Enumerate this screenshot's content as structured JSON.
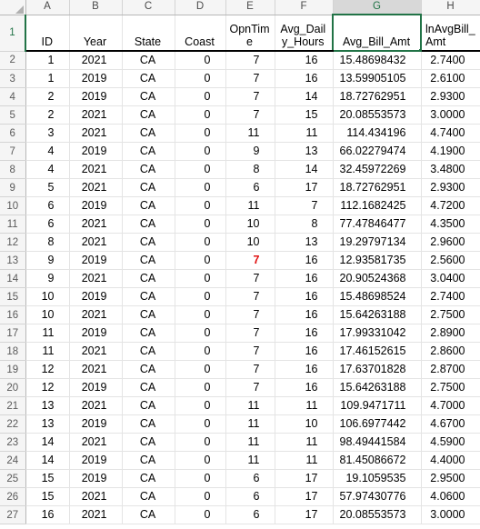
{
  "app": {
    "name": "spreadsheet",
    "active_cell": "G1",
    "selected_column": "G",
    "accent_color": "#217346",
    "alert_color": "#e01010"
  },
  "columns": {
    "letters": [
      "A",
      "B",
      "C",
      "D",
      "E",
      "F",
      "G",
      "H"
    ]
  },
  "headers": {
    "A": "ID",
    "B": "Year",
    "C": "State",
    "D": "Coast",
    "E": "OpnTime",
    "F": "Avg_Daily_Hours",
    "G": "Avg_Bill_Amt",
    "H": "lnAvgBill_Amt"
  },
  "row_numbers": [
    1,
    2,
    3,
    4,
    5,
    6,
    7,
    8,
    9,
    10,
    11,
    12,
    13,
    14,
    15,
    16,
    17,
    18,
    19,
    20,
    21,
    22,
    23,
    24,
    25,
    26,
    27
  ],
  "rows": [
    {
      "row": 2,
      "ID": "1",
      "Year": "2021",
      "State": "CA",
      "Coast": "0",
      "OpnTime": "7",
      "Avg_Daily_Hours": "16",
      "Avg_Bill_Amt": "15.48698432",
      "lnAvgBill_Amt": "2.7400",
      "opntime_red": false
    },
    {
      "row": 3,
      "ID": "1",
      "Year": "2019",
      "State": "CA",
      "Coast": "0",
      "OpnTime": "7",
      "Avg_Daily_Hours": "16",
      "Avg_Bill_Amt": "13.59905105",
      "lnAvgBill_Amt": "2.6100",
      "opntime_red": false
    },
    {
      "row": 4,
      "ID": "2",
      "Year": "2019",
      "State": "CA",
      "Coast": "0",
      "OpnTime": "7",
      "Avg_Daily_Hours": "14",
      "Avg_Bill_Amt": "18.72762951",
      "lnAvgBill_Amt": "2.9300",
      "opntime_red": false
    },
    {
      "row": 5,
      "ID": "2",
      "Year": "2021",
      "State": "CA",
      "Coast": "0",
      "OpnTime": "7",
      "Avg_Daily_Hours": "15",
      "Avg_Bill_Amt": "20.08553573",
      "lnAvgBill_Amt": "3.0000",
      "opntime_red": false
    },
    {
      "row": 6,
      "ID": "3",
      "Year": "2021",
      "State": "CA",
      "Coast": "0",
      "OpnTime": "11",
      "Avg_Daily_Hours": "11",
      "Avg_Bill_Amt": "114.434196",
      "lnAvgBill_Amt": "4.7400",
      "opntime_red": false
    },
    {
      "row": 7,
      "ID": "4",
      "Year": "2019",
      "State": "CA",
      "Coast": "0",
      "OpnTime": "9",
      "Avg_Daily_Hours": "13",
      "Avg_Bill_Amt": "66.02279474",
      "lnAvgBill_Amt": "4.1900",
      "opntime_red": false
    },
    {
      "row": 8,
      "ID": "4",
      "Year": "2021",
      "State": "CA",
      "Coast": "0",
      "OpnTime": "8",
      "Avg_Daily_Hours": "14",
      "Avg_Bill_Amt": "32.45972269",
      "lnAvgBill_Amt": "3.4800",
      "opntime_red": false
    },
    {
      "row": 9,
      "ID": "5",
      "Year": "2021",
      "State": "CA",
      "Coast": "0",
      "OpnTime": "6",
      "Avg_Daily_Hours": "17",
      "Avg_Bill_Amt": "18.72762951",
      "lnAvgBill_Amt": "2.9300",
      "opntime_red": false
    },
    {
      "row": 10,
      "ID": "6",
      "Year": "2019",
      "State": "CA",
      "Coast": "0",
      "OpnTime": "11",
      "Avg_Daily_Hours": "7",
      "Avg_Bill_Amt": "112.1682425",
      "lnAvgBill_Amt": "4.7200",
      "opntime_red": false
    },
    {
      "row": 11,
      "ID": "6",
      "Year": "2021",
      "State": "CA",
      "Coast": "0",
      "OpnTime": "10",
      "Avg_Daily_Hours": "8",
      "Avg_Bill_Amt": "77.47846477",
      "lnAvgBill_Amt": "4.3500",
      "opntime_red": false
    },
    {
      "row": 12,
      "ID": "8",
      "Year": "2021",
      "State": "CA",
      "Coast": "0",
      "OpnTime": "10",
      "Avg_Daily_Hours": "13",
      "Avg_Bill_Amt": "19.29797134",
      "lnAvgBill_Amt": "2.9600",
      "opntime_red": false
    },
    {
      "row": 13,
      "ID": "9",
      "Year": "2019",
      "State": "CA",
      "Coast": "0",
      "OpnTime": "7",
      "Avg_Daily_Hours": "16",
      "Avg_Bill_Amt": "12.93581735",
      "lnAvgBill_Amt": "2.5600",
      "opntime_red": true
    },
    {
      "row": 14,
      "ID": "9",
      "Year": "2021",
      "State": "CA",
      "Coast": "0",
      "OpnTime": "7",
      "Avg_Daily_Hours": "16",
      "Avg_Bill_Amt": "20.90524368",
      "lnAvgBill_Amt": "3.0400",
      "opntime_red": false
    },
    {
      "row": 15,
      "ID": "10",
      "Year": "2019",
      "State": "CA",
      "Coast": "0",
      "OpnTime": "7",
      "Avg_Daily_Hours": "16",
      "Avg_Bill_Amt": "15.48698524",
      "lnAvgBill_Amt": "2.7400",
      "opntime_red": false
    },
    {
      "row": 16,
      "ID": "10",
      "Year": "2021",
      "State": "CA",
      "Coast": "0",
      "OpnTime": "7",
      "Avg_Daily_Hours": "16",
      "Avg_Bill_Amt": "15.64263188",
      "lnAvgBill_Amt": "2.7500",
      "opntime_red": false
    },
    {
      "row": 17,
      "ID": "11",
      "Year": "2019",
      "State": "CA",
      "Coast": "0",
      "OpnTime": "7",
      "Avg_Daily_Hours": "16",
      "Avg_Bill_Amt": "17.99331042",
      "lnAvgBill_Amt": "2.8900",
      "opntime_red": false
    },
    {
      "row": 18,
      "ID": "11",
      "Year": "2021",
      "State": "CA",
      "Coast": "0",
      "OpnTime": "7",
      "Avg_Daily_Hours": "16",
      "Avg_Bill_Amt": "17.46152615",
      "lnAvgBill_Amt": "2.8600",
      "opntime_red": false
    },
    {
      "row": 19,
      "ID": "12",
      "Year": "2021",
      "State": "CA",
      "Coast": "0",
      "OpnTime": "7",
      "Avg_Daily_Hours": "16",
      "Avg_Bill_Amt": "17.63701828",
      "lnAvgBill_Amt": "2.8700",
      "opntime_red": false
    },
    {
      "row": 20,
      "ID": "12",
      "Year": "2019",
      "State": "CA",
      "Coast": "0",
      "OpnTime": "7",
      "Avg_Daily_Hours": "16",
      "Avg_Bill_Amt": "15.64263188",
      "lnAvgBill_Amt": "2.7500",
      "opntime_red": false
    },
    {
      "row": 21,
      "ID": "13",
      "Year": "2021",
      "State": "CA",
      "Coast": "0",
      "OpnTime": "11",
      "Avg_Daily_Hours": "11",
      "Avg_Bill_Amt": "109.9471711",
      "lnAvgBill_Amt": "4.7000",
      "opntime_red": false
    },
    {
      "row": 22,
      "ID": "13",
      "Year": "2019",
      "State": "CA",
      "Coast": "0",
      "OpnTime": "11",
      "Avg_Daily_Hours": "10",
      "Avg_Bill_Amt": "106.6977442",
      "lnAvgBill_Amt": "4.6700",
      "opntime_red": false
    },
    {
      "row": 23,
      "ID": "14",
      "Year": "2021",
      "State": "CA",
      "Coast": "0",
      "OpnTime": "11",
      "Avg_Daily_Hours": "11",
      "Avg_Bill_Amt": "98.49441584",
      "lnAvgBill_Amt": "4.5900",
      "opntime_red": false
    },
    {
      "row": 24,
      "ID": "14",
      "Year": "2019",
      "State": "CA",
      "Coast": "0",
      "OpnTime": "11",
      "Avg_Daily_Hours": "11",
      "Avg_Bill_Amt": "81.45086672",
      "lnAvgBill_Amt": "4.4000",
      "opntime_red": false
    },
    {
      "row": 25,
      "ID": "15",
      "Year": "2019",
      "State": "CA",
      "Coast": "0",
      "OpnTime": "6",
      "Avg_Daily_Hours": "17",
      "Avg_Bill_Amt": "19.1059535",
      "lnAvgBill_Amt": "2.9500",
      "opntime_red": false
    },
    {
      "row": 26,
      "ID": "15",
      "Year": "2021",
      "State": "CA",
      "Coast": "0",
      "OpnTime": "6",
      "Avg_Daily_Hours": "17",
      "Avg_Bill_Amt": "57.97430776",
      "lnAvgBill_Amt": "4.0600",
      "opntime_red": false
    },
    {
      "row": 27,
      "ID": "16",
      "Year": "2021",
      "State": "CA",
      "Coast": "0",
      "OpnTime": "6",
      "Avg_Daily_Hours": "17",
      "Avg_Bill_Amt": "20.08553573",
      "lnAvgBill_Amt": "3.0000",
      "opntime_red": false
    }
  ]
}
